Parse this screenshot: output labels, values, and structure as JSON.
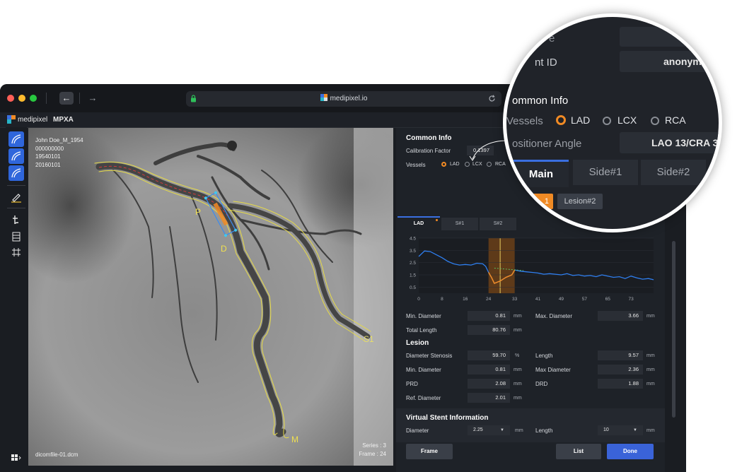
{
  "browser": {
    "url": "medipixel.io",
    "back_icon": "arrow-left-icon",
    "forward_icon": "arrow-right-icon",
    "reload_icon": "reload-icon",
    "lock_icon": "lock-icon"
  },
  "app": {
    "brand_name": "medipixel",
    "product_name": "MPXA"
  },
  "viewer": {
    "patient_name": "John Doe_M_1954",
    "patient_id": "000000000",
    "birth_date": "19540101",
    "study_date": "20160101",
    "filename": "dicomfile-01.dcm",
    "series": "Series : 3",
    "frame": "Frame : 24",
    "labels": {
      "proximal": "P",
      "distal": "D",
      "side1": "S1",
      "main": "M"
    }
  },
  "panel": {
    "common_info_title": "Common Info",
    "calibration_label": "Calibration Factor",
    "calibration_value": "0.1397",
    "vessels_label": "Vessels",
    "vessels": [
      {
        "label": "LAD",
        "selected": true
      },
      {
        "label": "LCX",
        "selected": false
      },
      {
        "label": "RCA",
        "selected": false
      }
    ],
    "tabs": [
      "LAD",
      "S#1",
      "S#2"
    ],
    "chart_y_ticks": [
      "4.5",
      "3.5",
      "2.5",
      "1.5",
      "0.5"
    ],
    "chart_x_ticks": [
      "0",
      "8",
      "16",
      "24",
      "33",
      "41",
      "49",
      "57",
      "65",
      "73"
    ],
    "min_diameter_label": "Min. Diameter",
    "min_diameter_value": "0.81",
    "max_diameter_label": "Max. Diameter",
    "max_diameter_value": "3.66",
    "total_length_label": "Total Length",
    "total_length_value": "80.76",
    "unit_mm": "mm",
    "unit_percent": "%",
    "lesion_title": "Lesion",
    "lesion": {
      "diameter_stenosis_label": "Diameter Stenosis",
      "diameter_stenosis_value": "59.70",
      "length_label": "Length",
      "length_value": "9.57",
      "min_diameter_label": "Min. Diameter",
      "min_diameter_value": "0.81",
      "max_diameter_label": "Max Diameter",
      "max_diameter_value": "2.36",
      "prd_label": "PRD",
      "prd_value": "2.08",
      "drd_label": "DRD",
      "drd_value": "1.88",
      "ref_diameter_label": "Ref. Diameter",
      "ref_diameter_value": "2.01"
    },
    "stent_title": "Virtual Stent Information",
    "stent_diameter_label": "Diameter",
    "stent_diameter_value": "2.25",
    "stent_length_label": "Length",
    "stent_length_value": "10",
    "frame_button": "Frame",
    "list_button": "List",
    "done_button": "Done"
  },
  "magnifier": {
    "row1_label": "e",
    "row2_label": "nt ID",
    "row2_value": "anonym",
    "common_info_title": "ommon Info",
    "vessels_label": "Vessels",
    "vessels": [
      {
        "label": "LAD",
        "selected": true
      },
      {
        "label": "LCX",
        "selected": false
      },
      {
        "label": "RCA",
        "selected": false
      }
    ],
    "positioner_label": "ositioner Angle",
    "positioner_value": "LAO 13/CRA 3",
    "tabs": [
      "Main",
      "Side#1",
      "Side#2"
    ],
    "lesion_tabs": [
      "1",
      "Lesion#2"
    ]
  },
  "colors": {
    "accent_blue": "#3a6fe0",
    "lesion_orange": "#f08a24",
    "vessel_yellow": "#f0e050",
    "curve_blue": "#2f7ff0"
  },
  "chart_data": {
    "type": "line",
    "title": "",
    "xlabel": "",
    "ylabel": "",
    "xlim": [
      0,
      80.76
    ],
    "ylim": [
      0,
      4.5
    ],
    "highlight_x_range": [
      24,
      33
    ],
    "series": [
      {
        "x": [
          0,
          2,
          4,
          6,
          8,
          10,
          12,
          14,
          16,
          18,
          20,
          22,
          23,
          24,
          25,
          26,
          28,
          30,
          32,
          33,
          35,
          37,
          39,
          41,
          43,
          45,
          47,
          49,
          51,
          53,
          55,
          57,
          59,
          61,
          63,
          65,
          67,
          69,
          71,
          73,
          75,
          77,
          79,
          80.76
        ],
        "values": [
          3.0,
          3.45,
          3.4,
          3.15,
          2.9,
          2.6,
          2.4,
          2.3,
          2.35,
          2.3,
          2.45,
          2.4,
          2.2,
          1.7,
          1.3,
          0.81,
          1.0,
          1.3,
          1.5,
          1.9,
          1.8,
          1.75,
          1.7,
          1.65,
          1.55,
          1.6,
          1.55,
          1.5,
          1.6,
          1.45,
          1.5,
          1.4,
          1.45,
          1.35,
          1.5,
          1.4,
          1.3,
          1.35,
          1.2,
          1.4,
          1.25,
          1.15,
          1.2,
          1.1
        ]
      }
    ]
  }
}
